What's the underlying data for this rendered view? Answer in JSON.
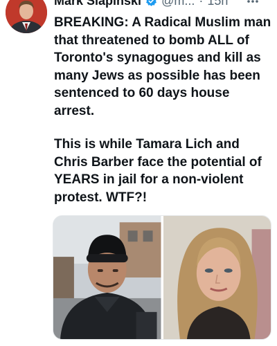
{
  "tweet": {
    "author": {
      "display_name": "Mark Slapinski",
      "handle": "@m...",
      "separator": "·",
      "time": "15h",
      "verified": true,
      "avatar_bg": "#b8322f"
    },
    "paragraphs": [
      "BREAKING: A Radical Muslim man that threatened to bomb ALL of Toronto's synagogues and kill as many Jews as possible has been sentenced to 60 days house arrest.",
      "This is while Tamara Lich and Chris Barber face the potential of YEARS in jail for a non-violent protest. WTF?!"
    ],
    "media": [
      {
        "icon": "man-in-black-beanie-photo"
      },
      {
        "icon": "woman-with-blonde-hair-photo"
      }
    ],
    "colors": {
      "text": "#0f1419",
      "secondary": "#536471",
      "verified": "#1d9bf0"
    }
  }
}
